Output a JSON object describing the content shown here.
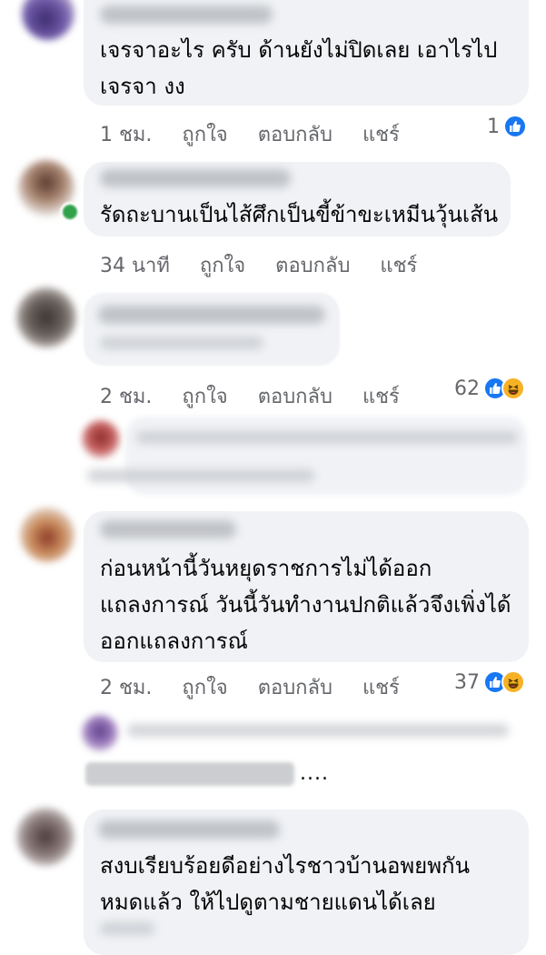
{
  "comments": [
    {
      "text_lines": [
        "เจรจาอะไร ครับ ด้านยังไม่ปิดเลย เอาไรไป",
        "เจรจา งง"
      ],
      "time": "1 ชม.",
      "like": "ถูกใจ",
      "reply": "ตอบกลับ",
      "share": "แชร์",
      "reactions": "1"
    },
    {
      "text_lines": [
        "รัดถะบานเป็นไส้ศึกเป็นขี้ข้าขะเหมีนวุ้นเส้น"
      ],
      "time": "34 นาที",
      "like": "ถูกใจ",
      "reply": "ตอบกลับ",
      "share": "แชร์",
      "reactions": ""
    },
    {
      "text_lines": [],
      "time": "2 ชม.",
      "like": "ถูกใจ",
      "reply": "ตอบกลับ",
      "share": "แชร์",
      "reactions": "62"
    },
    {
      "text_lines": [
        "ก่อนหน้านี้วันหยุดราชการไม่ได้ออก",
        "แถลงการณ์ วันนี้วันทำงานปกติแล้วจึงเพิ่งได้",
        "ออกแถลงการณ์"
      ],
      "time": "2 ชม.",
      "like": "ถูกใจ",
      "reply": "ตอบกลับ",
      "share": "แชร์",
      "reactions": "37"
    },
    {
      "text_lines": [
        "สงบเรียบร้อยดีอย่างไรชาวบ้านอพยพกัน",
        "หมดแล้ว ให้ไปดูตามชายแดนได้เลย"
      ]
    }
  ],
  "reply_link_dots": "....",
  "colors": {
    "bubble": "#f0f2f5",
    "meta": "#65676b",
    "like_blue": "#1877f2",
    "haha_yellow": "#f7b125"
  }
}
